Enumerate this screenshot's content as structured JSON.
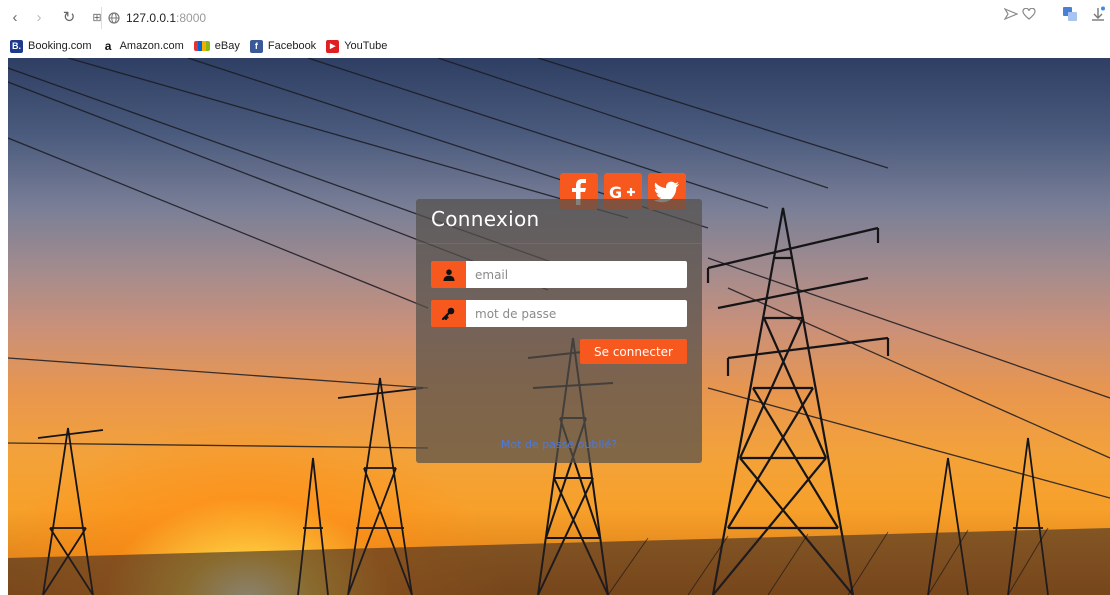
{
  "browser": {
    "url_host": "127.0.0.1",
    "url_port": ":8000",
    "bookmarks": [
      {
        "label": "Booking.com",
        "icon": "booking-icon",
        "color": "#1f3a8a",
        "glyph": "B."
      },
      {
        "label": "Amazon.com",
        "icon": "amazon-icon",
        "color": "#ffffff",
        "glyph": "a"
      },
      {
        "label": "eBay",
        "icon": "ebay-icon",
        "color": "#ffffff",
        "glyph": ""
      },
      {
        "label": "Facebook",
        "icon": "facebook-icon",
        "color": "#3b5998",
        "glyph": "f"
      },
      {
        "label": "YouTube",
        "icon": "youtube-icon",
        "color": "#e02020",
        "glyph": "▶"
      }
    ]
  },
  "social": [
    "facebook-icon",
    "google-plus-icon",
    "twitter-icon"
  ],
  "login": {
    "title": "Connexion",
    "email_placeholder": "email",
    "password_placeholder": "mot de passe",
    "submit_label": "Se connecter",
    "forgot_label": "Mot de passe oublié?"
  },
  "colors": {
    "accent": "#f7581e",
    "link": "#4e79d6"
  }
}
